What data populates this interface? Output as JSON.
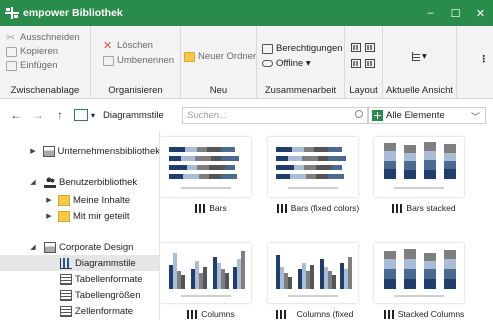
{
  "window": {
    "title": "empower Bibliothek",
    "controls": {
      "minimize": "–",
      "maximize": "☐",
      "close": "✕"
    }
  },
  "ribbon": {
    "clipboard": {
      "label": "Zwischenablage",
      "cut": "Ausschneiden",
      "copy": "Kopieren",
      "paste": "Einfügen"
    },
    "organize": {
      "label": "Organisieren",
      "delete": "Löschen",
      "rename": "Umbenennen"
    },
    "new": {
      "label": "Neu",
      "new_folder": "Neuer Ordner"
    },
    "collaboration": {
      "label": "Zusammenarbeit",
      "permissions": "Berechtigungen",
      "offline": "Offline ▾"
    },
    "layout": {
      "label": "Layout"
    },
    "view": {
      "label": "Aktuelle Ansicht",
      "dropdown": "▾"
    },
    "overflow": "⋮"
  },
  "address": {
    "back": "←",
    "forward": "→",
    "up": "↑",
    "crumb_dropdown": "▾",
    "crumb": "Diagrammstile",
    "search_placeholder": "Suchen...",
    "filter_value": "Alle Elemente"
  },
  "sidebar": {
    "items": [
      {
        "label": "Unternehmensbibliothek",
        "arrow": "▶"
      },
      {
        "label": "Benutzerbibliothek",
        "arrow": "◢"
      },
      {
        "label": "Meine Inhalte",
        "arrow": "▶"
      },
      {
        "label": "Mit mir geteilt",
        "arrow": "▶"
      },
      {
        "label": "Corporate Design",
        "arrow": "◢"
      },
      {
        "label": "Diagrammstile",
        "arrow": ""
      },
      {
        "label": "Tabellenformate",
        "arrow": ""
      },
      {
        "label": "Tabellengrößen",
        "arrow": ""
      },
      {
        "label": "Zellenformate",
        "arrow": ""
      }
    ]
  },
  "tiles": [
    {
      "label": "Bars"
    },
    {
      "label": "Bars (fixed colors)"
    },
    {
      "label": "Bars stacked"
    },
    {
      "label": "Columns"
    },
    {
      "label": "Columns (fixed colors)"
    },
    {
      "label": "Stacked Columns"
    }
  ],
  "colors": {
    "titlebar": "#2a8c4a",
    "navy": "#1f3e6e",
    "steel": "#4b6a92",
    "light_blue": "#a9bdd6",
    "gray": "#7f7f7f",
    "dark_gray": "#555555"
  }
}
